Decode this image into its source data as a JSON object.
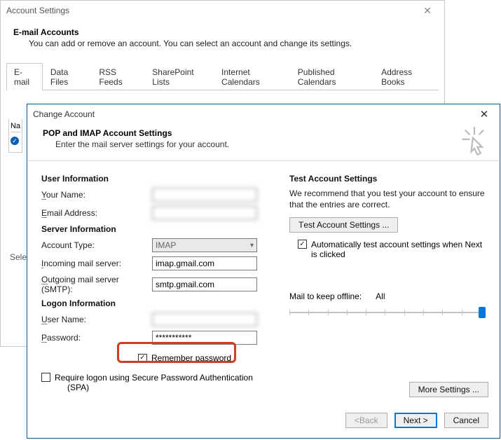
{
  "backWindow": {
    "title": "Account Settings",
    "heading": "E-mail Accounts",
    "subheading": "You can add or remove an account. You can select an account and change its settings.",
    "tabs": [
      "E-mail",
      "Data Files",
      "RSS Feeds",
      "SharePoint Lists",
      "Internet Calendars",
      "Published Calendars",
      "Address Books"
    ],
    "nameColHeader": "Na",
    "truncatedSelect": "Sele"
  },
  "frontWindow": {
    "title": "Change Account",
    "heading": "POP and IMAP Account Settings",
    "subheading": "Enter the mail server settings for your account.",
    "sections": {
      "user": "User Information",
      "server": "Server Information",
      "logon": "Logon Information",
      "test": "Test Account Settings"
    },
    "labels": {
      "yourName": "Your Name:",
      "email": "Email Address:",
      "accountType": "Account Type:",
      "incoming": "Incoming mail server:",
      "outgoing": "Outgoing mail server (SMTP):",
      "userName": "User Name:",
      "password": "Password:",
      "remember": "Remember password",
      "spa": "Require logon using Secure Password Authentication (SPA)",
      "mailKeep": "Mail to keep offline:",
      "mailKeepValue": "All"
    },
    "values": {
      "accountType": "IMAP",
      "incoming": "imap.gmail.com",
      "outgoing": "smtp.gmail.com",
      "password": "***********"
    },
    "rightText": "We recommend that you test your account to ensure that the entries are correct.",
    "buttons": {
      "testAccount": "Test Account Settings ...",
      "autoTest": "Automatically test account settings when Next is clicked",
      "moreSettings": "More Settings ...",
      "back": "< Back",
      "next": "Next >",
      "cancel": "Cancel"
    }
  }
}
